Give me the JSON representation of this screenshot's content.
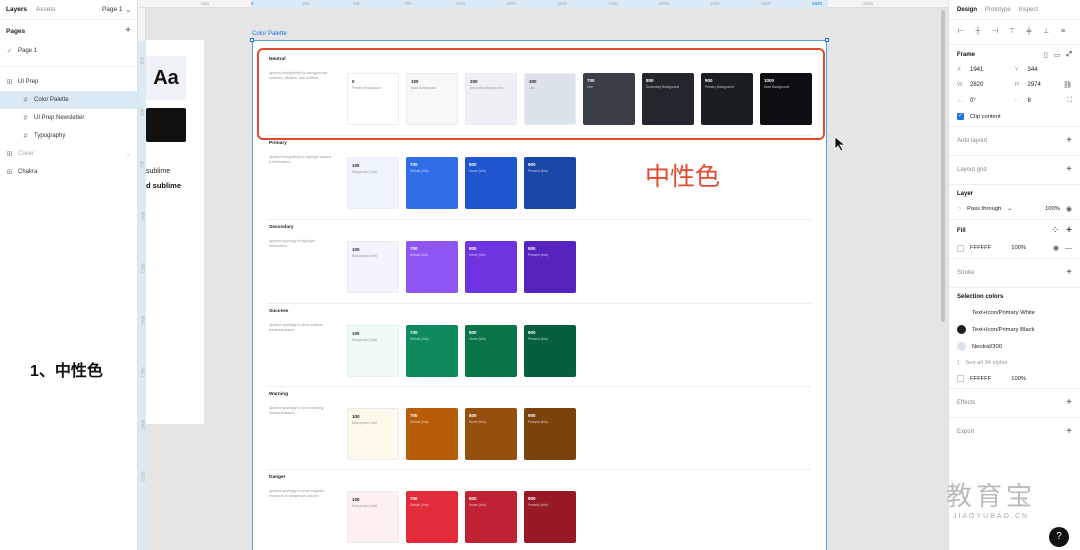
{
  "left_panel": {
    "tabs": [
      "Layers",
      "Assets"
    ],
    "page_selector": "Page 1",
    "pages_title": "Pages",
    "pages": [
      "Page 1"
    ],
    "layers": [
      {
        "label": "UI Prep",
        "level": 0,
        "selected": false,
        "dim": false
      },
      {
        "label": "Color Palette",
        "level": 1,
        "selected": true,
        "dim": false
      },
      {
        "label": "UI Prep Newsletter",
        "level": 1,
        "selected": false,
        "dim": false
      },
      {
        "label": "Typography",
        "level": 1,
        "selected": false,
        "dim": false
      },
      {
        "label": "Cover",
        "level": 0,
        "selected": false,
        "dim": true
      },
      {
        "label": "Chakra",
        "level": 0,
        "selected": false,
        "dim": false
      }
    ]
  },
  "canvas": {
    "ruler_top": [
      "-250",
      "0",
      "250",
      "500",
      "750",
      "1000",
      "1250",
      "1500",
      "1750",
      "2000",
      "2250",
      "2500",
      "2820",
      "3250"
    ],
    "ruler_left": [
      "250",
      "500",
      "750",
      "1000",
      "1250",
      "1500",
      "1750",
      "2000",
      "2250"
    ],
    "frame_label": "Color Palette",
    "other_frame": {
      "aa": "Aa",
      "text1": "sublime",
      "text2": "d sublime"
    },
    "annotation": "中性色",
    "left_annotation": "1、中性色",
    "groups": [
      {
        "title": "Neutral",
        "desc": "Applied thoughtfully for backgrounds, surfaces, dividers, and outlines.",
        "swatches": [
          {
            "value": "0",
            "label": "Primary Background",
            "color": "#ffffff",
            "dark": false
          },
          {
            "value": "100",
            "label": "Base Background",
            "color": "#f7f8fa",
            "dark": false
          },
          {
            "value": "200",
            "label": "Secondary Background",
            "color": "#eef0f6",
            "dark": false
          },
          {
            "value": "300",
            "label": "Line",
            "color": "#dde3ec",
            "dark": false
          },
          {
            "value": "700",
            "label": "Line",
            "color": "#3a3f47",
            "dark": true
          },
          {
            "value": "800",
            "label": "Secondary Background",
            "color": "#23262c",
            "dark": true
          },
          {
            "value": "900",
            "label": "Primary Background",
            "color": "#1a1d22",
            "dark": true
          },
          {
            "value": "1000",
            "label": "Base Background",
            "color": "#0d0f13",
            "dark": true
          }
        ]
      },
      {
        "title": "Primary",
        "desc": "Applied thoughtfully to highlight actions & information.",
        "swatches": [
          {
            "value": "100",
            "label": "Background (Info)",
            "color": "#eef4fe",
            "dark": false
          },
          {
            "value": "700",
            "label": "Default (Info)",
            "color": "#2e6de6",
            "dark": true
          },
          {
            "value": "800",
            "label": "Hover (Info)",
            "color": "#1f56d0",
            "dark": true
          },
          {
            "value": "900",
            "label": "Pressed (Info)",
            "color": "#1b47a8",
            "dark": true
          }
        ]
      },
      {
        "title": "Secondary",
        "desc": "Applied sparingly to highlight information.",
        "swatches": [
          {
            "value": "100",
            "label": "Background (Info)",
            "color": "#f6f2fe",
            "dark": false
          },
          {
            "value": "700",
            "label": "Default (Info)",
            "color": "#8f55f2",
            "dark": true
          },
          {
            "value": "800",
            "label": "Hover (Info)",
            "color": "#6d34e0",
            "dark": true
          },
          {
            "value": "900",
            "label": "Pressed (Info)",
            "color": "#5524bd",
            "dark": true
          }
        ]
      },
      {
        "title": "Success",
        "desc": "Applied sparingly to show positive feedback/status.",
        "swatches": [
          {
            "value": "100",
            "label": "Background (Info)",
            "color": "#eefcf5",
            "dark": false
          },
          {
            "value": "700",
            "label": "Default (Info)",
            "color": "#0e8a5c",
            "dark": true
          },
          {
            "value": "800",
            "label": "Hover (Info)",
            "color": "#0a7449",
            "dark": true
          },
          {
            "value": "900",
            "label": "Pressed (Info)",
            "color": "#07603c",
            "dark": true
          }
        ]
      },
      {
        "title": "Warning",
        "desc": "Applied sparingly to show warning feedback/status.",
        "swatches": [
          {
            "value": "100",
            "label": "Background (Info)",
            "color": "#fff9ec",
            "dark": false
          },
          {
            "value": "700",
            "label": "Default (Info)",
            "color": "#b85c07",
            "dark": true
          },
          {
            "value": "800",
            "label": "Hover (Info)",
            "color": "#95500e",
            "dark": true
          },
          {
            "value": "900",
            "label": "Pressed (Info)",
            "color": "#7a430c",
            "dark": true
          }
        ]
      },
      {
        "title": "Danger",
        "desc": "Applied sparingly to show negative feedback or dangerous actions.",
        "swatches": [
          {
            "value": "100",
            "label": "Background (Info)",
            "color": "#fef0f1",
            "dark": false
          },
          {
            "value": "700",
            "label": "Default (Info)",
            "color": "#e22b3b",
            "dark": true
          },
          {
            "value": "800",
            "label": "Hover (Info)",
            "color": "#bf2232",
            "dark": true
          },
          {
            "value": "900",
            "label": "Pressed (Info)",
            "color": "#981a26",
            "dark": true
          }
        ]
      }
    ]
  },
  "right_panel": {
    "tabs": [
      "Design",
      "Prototype",
      "Inspect"
    ],
    "frame_title": "Frame",
    "x_label": "X",
    "x": "1941",
    "y_label": "Y",
    "y": "344",
    "w_label": "W",
    "w": "2820",
    "h_label": "H",
    "h": "2974",
    "rotation": "0°",
    "radius": "8",
    "clip_content": "Clip content",
    "auto_layout": "Auto layout",
    "layout_grid": "Layout grid",
    "layer_title": "Layer",
    "blend_mode": "Pass through",
    "opacity": "100%",
    "fill_title": "Fill",
    "fill_hex": "FFFFFF",
    "fill_opacity": "100%",
    "stroke_title": "Stroke",
    "selection_colors_title": "Selection colors",
    "selection_colors": [
      {
        "label": "Text+Icon/Primary White",
        "color": "#ffffff",
        "marker": "none"
      },
      {
        "label": "Text+Icon/Primary Black",
        "color": "#1a1d22",
        "marker": "dot"
      },
      {
        "label": "Neutral/300",
        "color": "#dde3ec",
        "marker": "dot"
      }
    ],
    "see_all": "See all 34 styles",
    "selection_hex": "FFFFFF",
    "selection_hex_opacity": "100%",
    "effects_title": "Effects",
    "export_title": "Export"
  },
  "watermark": {
    "line1": "教育宝",
    "line2": "JIAOYUBAO.CN"
  },
  "help_label": "?",
  "colors": {
    "accent": "#1a73e8",
    "annotation": "#e04a2f"
  }
}
